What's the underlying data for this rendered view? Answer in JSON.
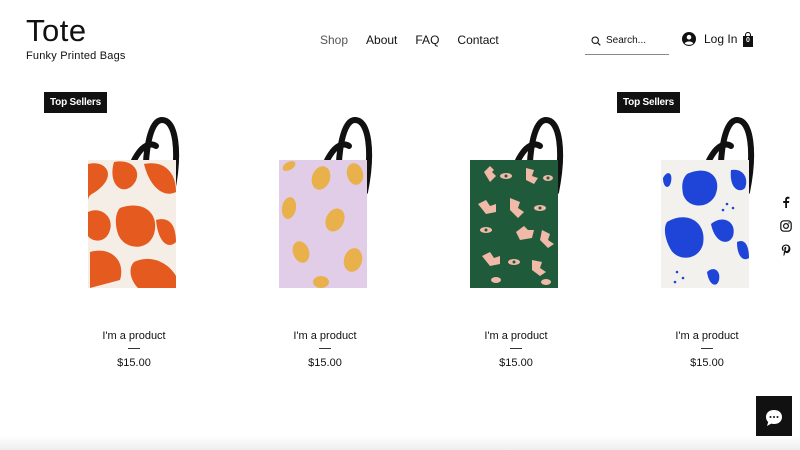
{
  "header": {
    "logo_title": "Tote",
    "logo_tagline": "Funky Printed Bags",
    "nav": [
      "Shop",
      "About",
      "FAQ",
      "Contact"
    ],
    "search_placeholder": "Search...",
    "login_label": "Log In",
    "cart_count": "0"
  },
  "products": [
    {
      "name": "I'm a product",
      "price": "$15.00",
      "badge": "Top Sellers",
      "print": "orange-abstract",
      "colors": [
        "#e45a1f",
        "#f4eee6"
      ]
    },
    {
      "name": "I'm a product",
      "price": "$15.00",
      "badge": "",
      "print": "lemons",
      "colors": [
        "#e8b14c",
        "#e1cde8"
      ]
    },
    {
      "name": "I'm a product",
      "price": "$15.00",
      "badge": "",
      "print": "hands-eyes",
      "colors": [
        "#1f5b3a",
        "#f0b9a8"
      ]
    },
    {
      "name": "I'm a product",
      "price": "$15.00",
      "badge": "Top Sellers",
      "print": "blue-blobs",
      "colors": [
        "#1e45d8",
        "#f3f1ee"
      ]
    }
  ],
  "social": [
    "facebook-icon",
    "instagram-icon",
    "pinterest-icon"
  ],
  "chat": {
    "icon": "chat-icon"
  }
}
